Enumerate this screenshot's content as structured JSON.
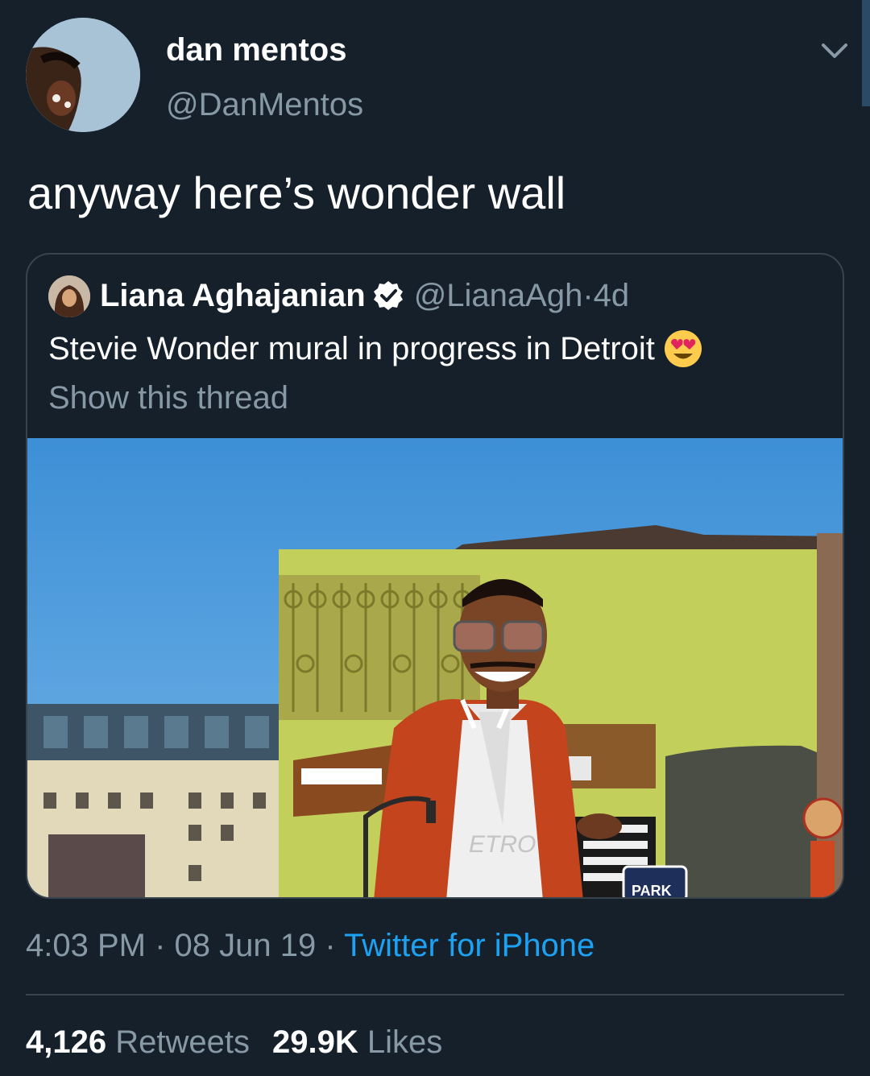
{
  "tweet": {
    "author_name": "dan mentos",
    "author_handle": "@DanMentos",
    "text": "anyway here’s wonder wall",
    "avatar_icon": "user-avatar-photo",
    "menu_icon": "chevron-down-icon"
  },
  "quoted_tweet": {
    "author_name": "Liana Aghajanian",
    "verified_icon": "verified-badge-icon",
    "author_handle": "@LianaAgh",
    "separator": " · ",
    "age": "4d",
    "text": "Stevie Wonder mural in progress in Detroit",
    "emoji": "heart-eyes-emoji",
    "show_thread": "Show this thread",
    "image_labels": {
      "jacket_text": "ETRO",
      "sign_text": "PARK"
    }
  },
  "meta": {
    "time": "4:03 PM",
    "separator": " · ",
    "date": "08 Jun 19",
    "source": "Twitter for iPhone"
  },
  "stats": {
    "retweets_count": "4,126",
    "retweets_label": "Retweets",
    "likes_count": "29.9K",
    "likes_label": "Likes"
  },
  "colors": {
    "background": "#15202b",
    "secondary_text": "#8899a6",
    "link": "#1da1f2",
    "border": "#38444d"
  }
}
